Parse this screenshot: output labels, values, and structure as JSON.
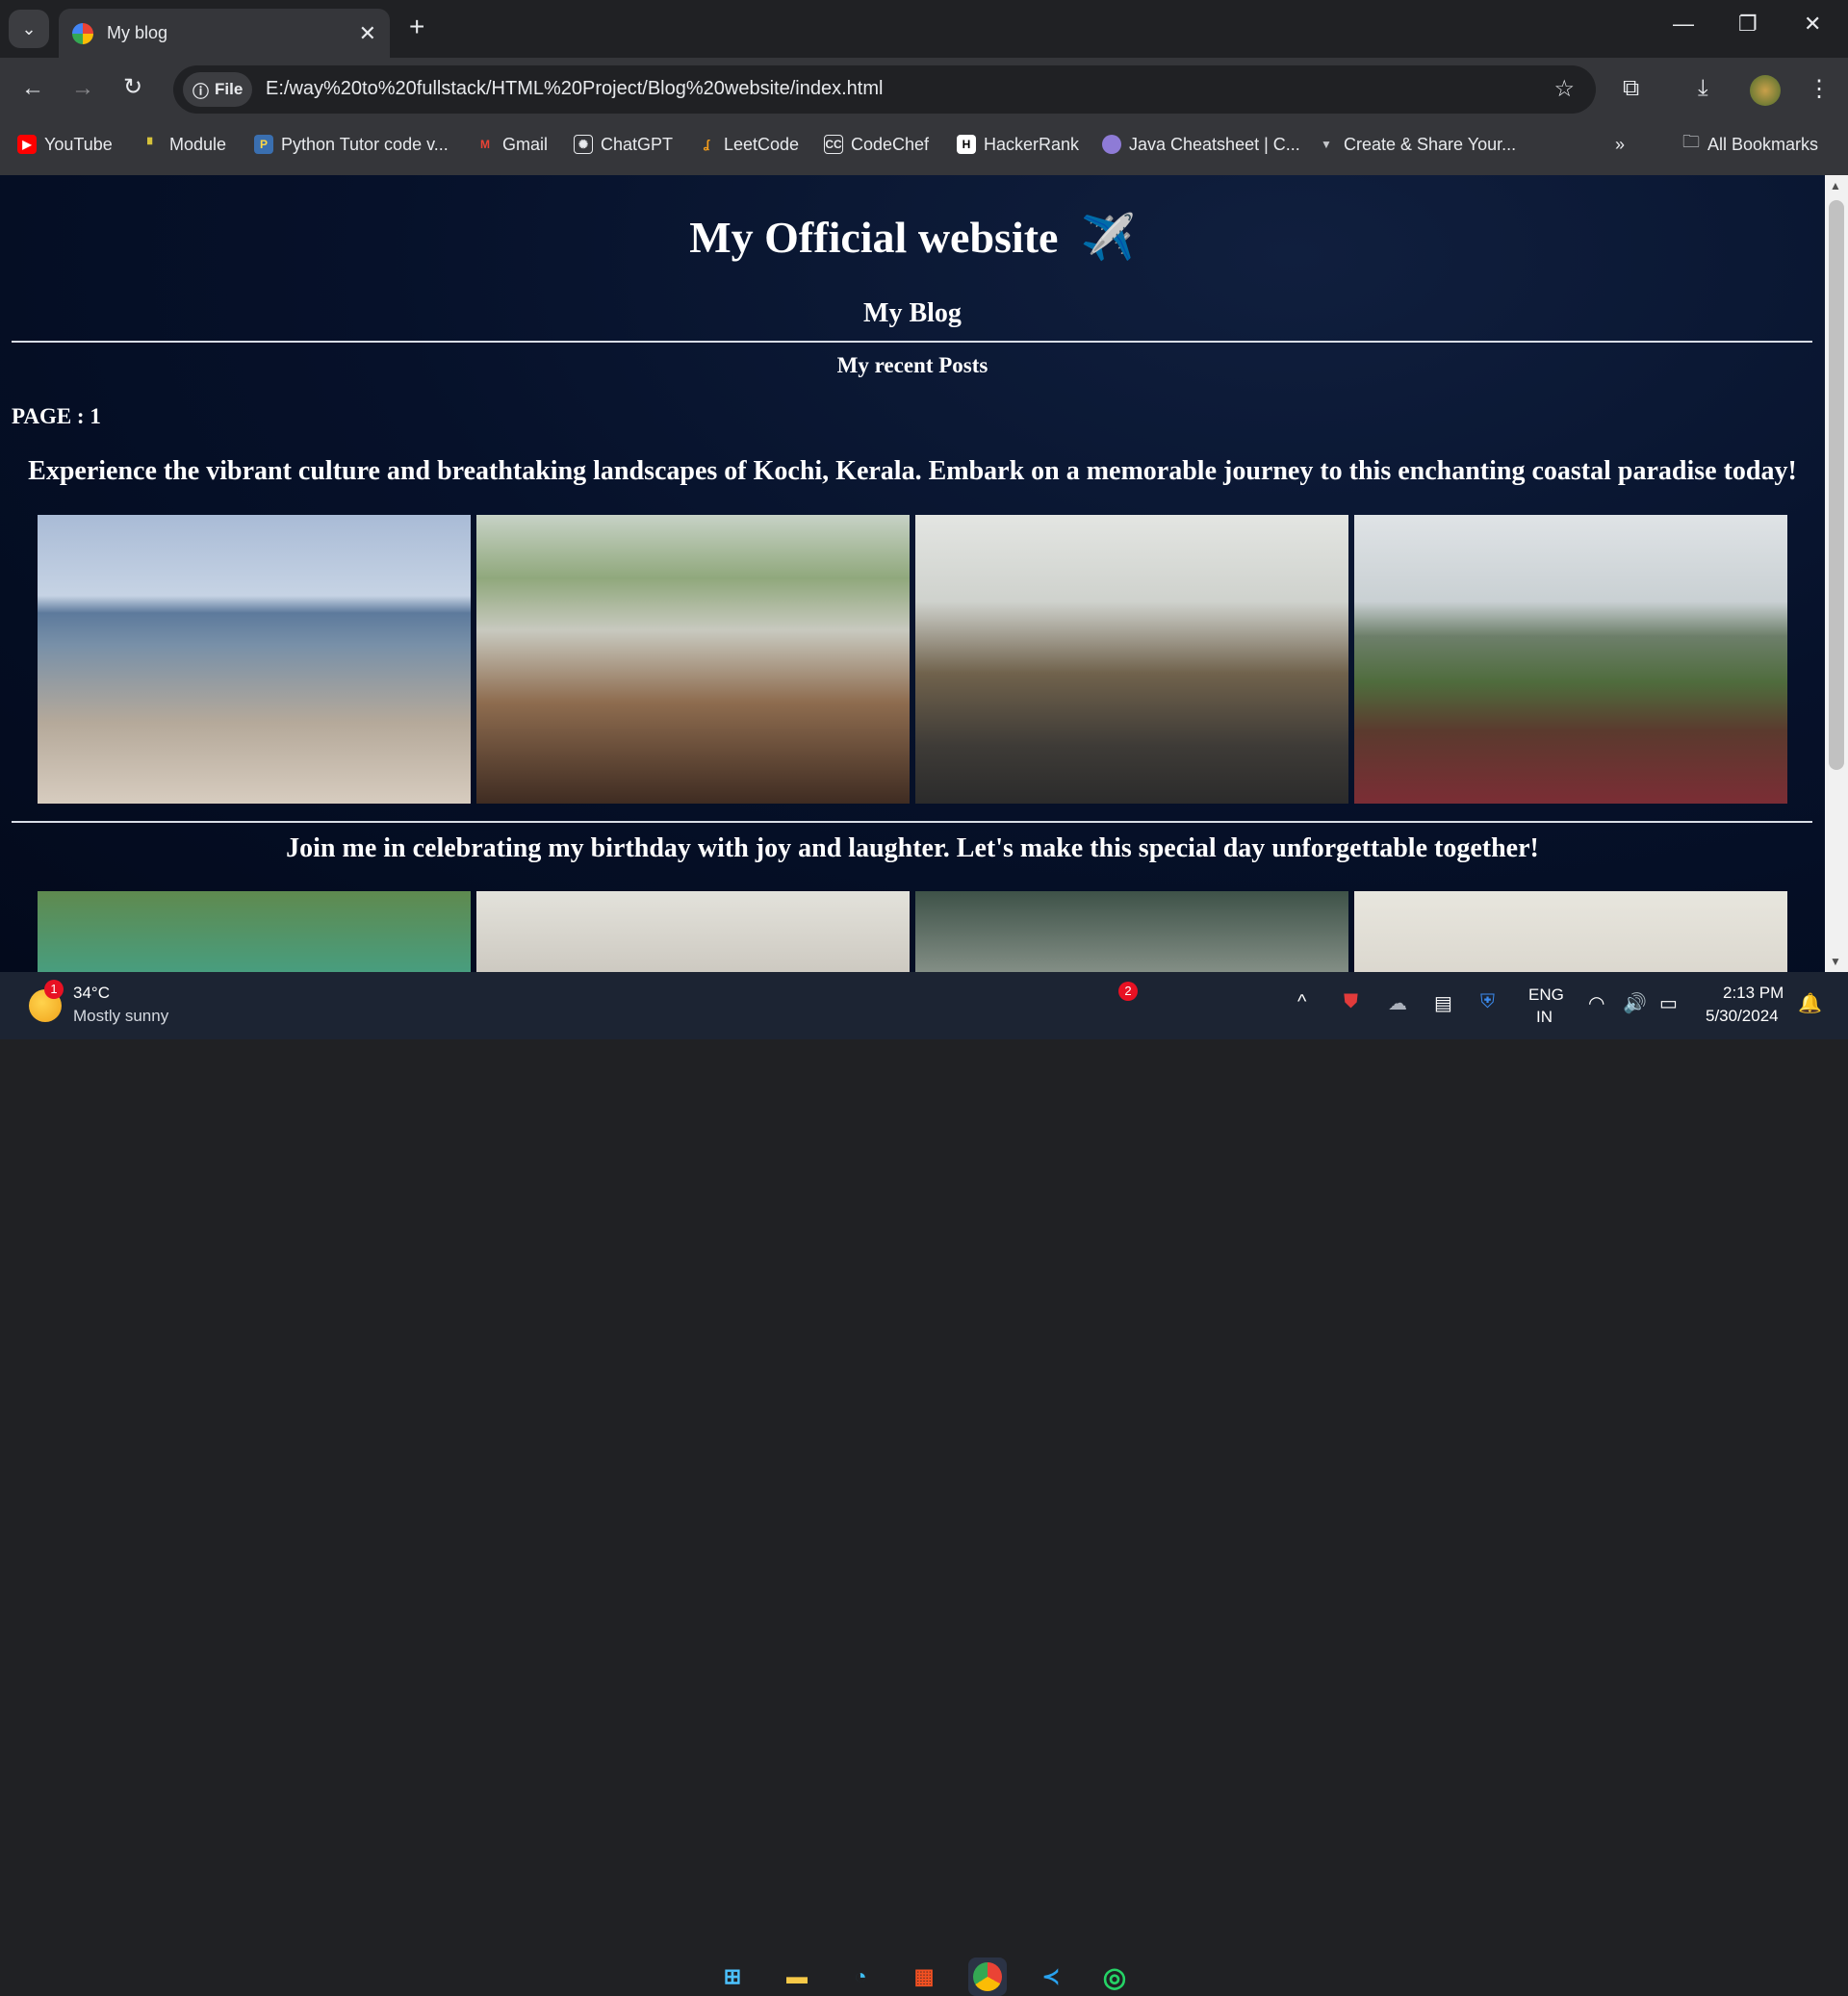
{
  "browser": {
    "tab_title": "My blog",
    "address_chip": "File",
    "url": "E:/way%20to%20fullstack/HTML%20Project/Blog%20website/index.html",
    "bookmarks": [
      "YouTube",
      "Module",
      "Python Tutor code v...",
      "Gmail",
      "ChatGPT",
      "LeetCode",
      "CodeChef",
      "HackerRank",
      "Java Cheatsheet | C...",
      "Create & Share Your..."
    ],
    "all_bookmarks": "All Bookmarks",
    "overflow_glyph": "»"
  },
  "page": {
    "title": "My Official website",
    "title_emoji": "✈️",
    "subtitle": "My Blog",
    "section_heading": "My recent Posts",
    "page_label": "PAGE : 1",
    "posts": [
      {
        "caption": "Experience the vibrant culture and breathtaking landscapes of Kochi, Kerala. Embark on a memorable journey to this enchanting coastal paradise today!"
      },
      {
        "caption": "Join me in celebrating my birthday with joy and laughter. Let's make this special day unforgettable together!"
      }
    ]
  },
  "taskbar": {
    "weather_temp": "34°C",
    "weather_desc": "Mostly sunny",
    "weather_badge": "1",
    "whatsapp_badge": "2",
    "lang_1": "ENG",
    "lang_2": "IN",
    "time": "2:13 PM",
    "date": "5/30/2024"
  },
  "colors": {
    "page_bg": "#06112a",
    "chrome_bg": "#35363a",
    "tabstrip_bg": "#202124",
    "taskbar_bg": "#1c2433"
  }
}
